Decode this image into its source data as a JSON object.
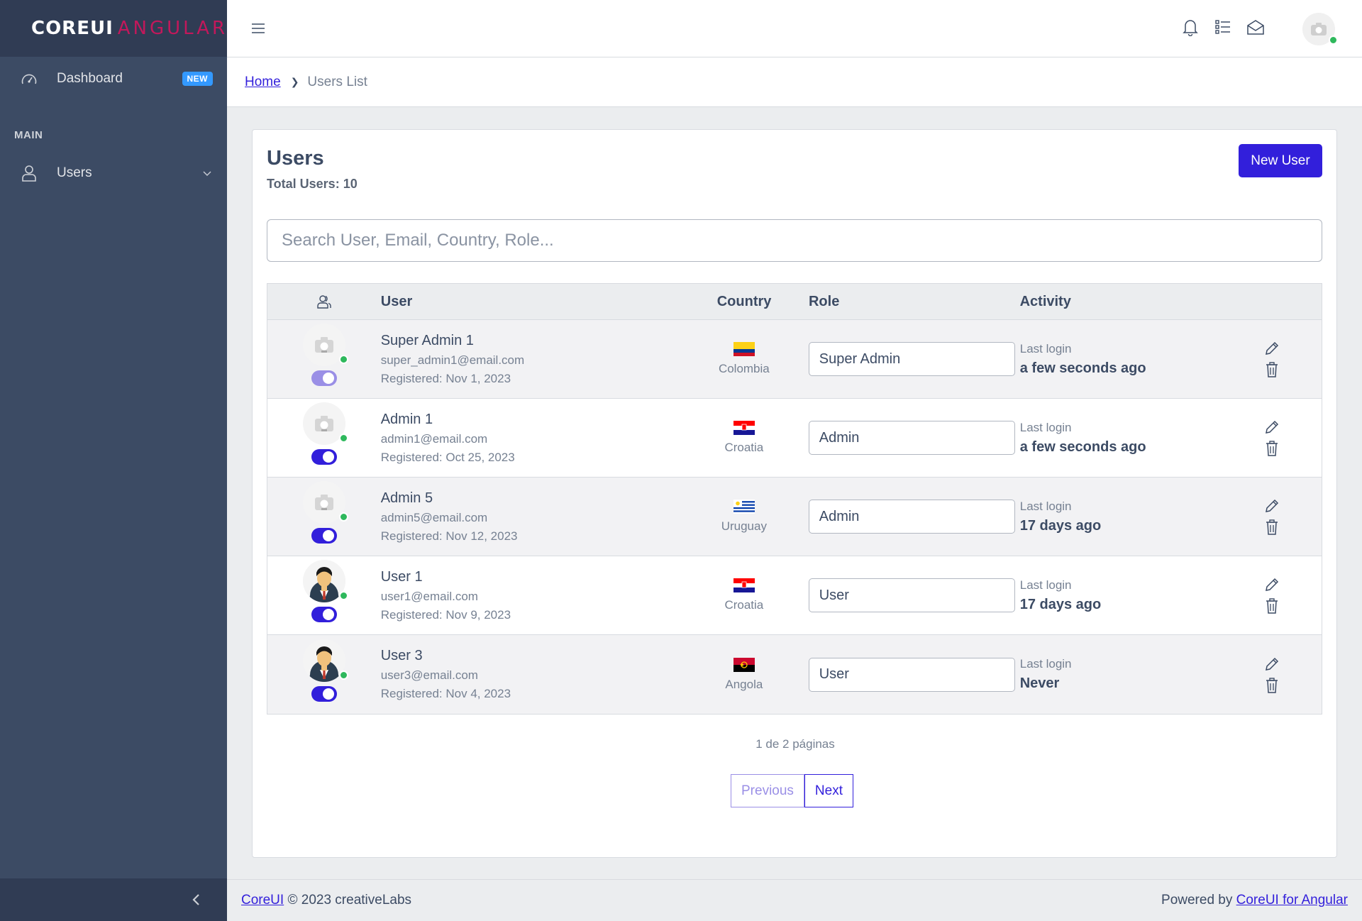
{
  "brand": {
    "core": "COREUI",
    "suffix": "ANGULAR"
  },
  "sidebar": {
    "items": [
      {
        "label": "Dashboard",
        "badge": "NEW",
        "icon": "speedometer-icon"
      },
      {
        "label": "Users",
        "icon": "user-icon"
      }
    ],
    "section_title": "MAIN"
  },
  "header": {
    "icons": [
      "bell-icon",
      "list-icon",
      "envelope-open-icon"
    ],
    "avatar": "camera-avatar"
  },
  "breadcrumb": {
    "home": "Home",
    "current": "Users List"
  },
  "card": {
    "title": "Users",
    "subtitle": "Total Users: 10",
    "new_button": "New User",
    "search_placeholder": "Search User, Email, Country, Role..."
  },
  "table": {
    "headers": {
      "user": "User",
      "country": "Country",
      "role": "Role",
      "activity": "Activity"
    },
    "rows": [
      {
        "name": "Super Admin 1",
        "email": "super_admin1@email.com",
        "registered": "Registered: Nov 1, 2023",
        "country": "Colombia",
        "role": "Super Admin",
        "login_label": "Last login",
        "login": "a few seconds ago",
        "avatar": "camera",
        "toggle": "light"
      },
      {
        "name": "Admin 1",
        "email": "admin1@email.com",
        "registered": "Registered: Oct 25, 2023",
        "country": "Croatia",
        "role": "Admin",
        "login_label": "Last login",
        "login": "a few seconds ago",
        "avatar": "camera",
        "toggle": "on"
      },
      {
        "name": "Admin 5",
        "email": "admin5@email.com",
        "registered": "Registered: Nov 12, 2023",
        "country": "Uruguay",
        "role": "Admin",
        "login_label": "Last login",
        "login": "17 days ago",
        "avatar": "camera",
        "toggle": "on"
      },
      {
        "name": "User 1",
        "email": "user1@email.com",
        "registered": "Registered: Nov 9, 2023",
        "country": "Croatia",
        "role": "User",
        "login_label": "Last login",
        "login": "17 days ago",
        "avatar": "person",
        "toggle": "on"
      },
      {
        "name": "User 3",
        "email": "user3@email.com",
        "registered": "Registered: Nov 4, 2023",
        "country": "Angola",
        "role": "User",
        "login_label": "Last login",
        "login": "Never",
        "avatar": "person",
        "toggle": "on"
      }
    ]
  },
  "pagination": {
    "info": "1 de 2 páginas",
    "previous": "Previous",
    "next": "Next"
  },
  "footer": {
    "left_link": "CoreUI",
    "left_text": "© 2023 creativeLabs",
    "right_text": "Powered by",
    "right_link": "CoreUI for Angular"
  },
  "colors": {
    "primary": "#321fdb",
    "sidebar": "#3c4b64",
    "success": "#2eb85c",
    "brand_accent": "#c2185b"
  }
}
